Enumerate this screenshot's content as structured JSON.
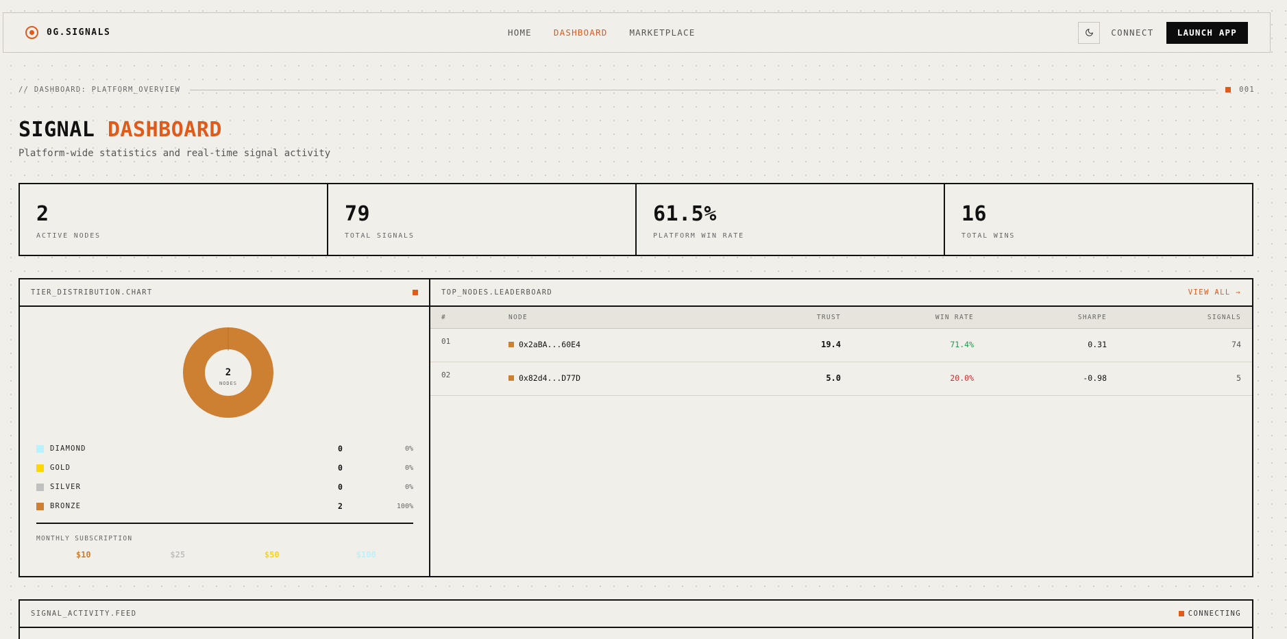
{
  "nav": {
    "brand": "0G.SIGNALS",
    "links": [
      {
        "label": "HOME",
        "active": false
      },
      {
        "label": "DASHBOARD",
        "active": true
      },
      {
        "label": "MARKETPLACE",
        "active": false
      }
    ],
    "connect_label": "CONNECT",
    "launch_label": "LAUNCH APP"
  },
  "breadcrumb": {
    "text": "// DASHBOARD: PLATFORM_OVERVIEW",
    "number": "001"
  },
  "header": {
    "title_part1": "SIGNAL",
    "title_part2": "DASHBOARD",
    "subtitle": "Platform-wide statistics and real-time signal activity"
  },
  "stats": [
    {
      "value": "2",
      "label": "ACTIVE NODES"
    },
    {
      "value": "79",
      "label": "TOTAL SIGNALS"
    },
    {
      "value": "61.5%",
      "label": "PLATFORM WIN RATE"
    },
    {
      "value": "16",
      "label": "TOTAL WINS"
    }
  ],
  "tier_panel": {
    "title": "TIER_DISTRIBUTION.CHART",
    "donut_center_value": "2",
    "donut_center_label": "NODES",
    "tiers": [
      {
        "name": "DIAMOND",
        "count": "0",
        "pct": "0%",
        "color": "#b9f2ff"
      },
      {
        "name": "GOLD",
        "count": "0",
        "pct": "0%",
        "color": "#ffd700"
      },
      {
        "name": "SILVER",
        "count": "0",
        "pct": "0%",
        "color": "#c0c0c0"
      },
      {
        "name": "BRONZE",
        "count": "2",
        "pct": "100%",
        "color": "#cd7f32"
      }
    ],
    "subscription_label": "MONTHLY SUBSCRIPTION",
    "prices": [
      {
        "value": "$10",
        "color": "#cd7f32"
      },
      {
        "value": "$25",
        "color": "#c0c0c0"
      },
      {
        "value": "$50",
        "color": "#ffd700"
      },
      {
        "value": "$100",
        "color": "#b9f2ff"
      }
    ]
  },
  "leaderboard": {
    "title": "TOP_NODES.LEADERBOARD",
    "view_all": "VIEW ALL →",
    "columns": {
      "rank": "#",
      "node": "NODE",
      "trust": "TRUST",
      "win_rate": "WIN RATE",
      "sharpe": "SHARPE",
      "signals": "SIGNALS"
    },
    "rows": [
      {
        "rank": "01",
        "node": "0x2aBA...60E4",
        "trust": "19.4",
        "win_rate": "71.4%",
        "win_color": "#1a9e4b",
        "sharpe": "0.31",
        "signals": "74"
      },
      {
        "rank": "02",
        "node": "0x82d4...D77D",
        "trust": "5.0",
        "win_rate": "20.0%",
        "win_color": "#d22a2a",
        "sharpe": "-0.98",
        "signals": "5"
      }
    ]
  },
  "feed": {
    "title": "SIGNAL_ACTIVITY.FEED",
    "status": "CONNECTING"
  },
  "colors": {
    "accent": "#e05a1c",
    "bronze": "#cd7f32"
  }
}
